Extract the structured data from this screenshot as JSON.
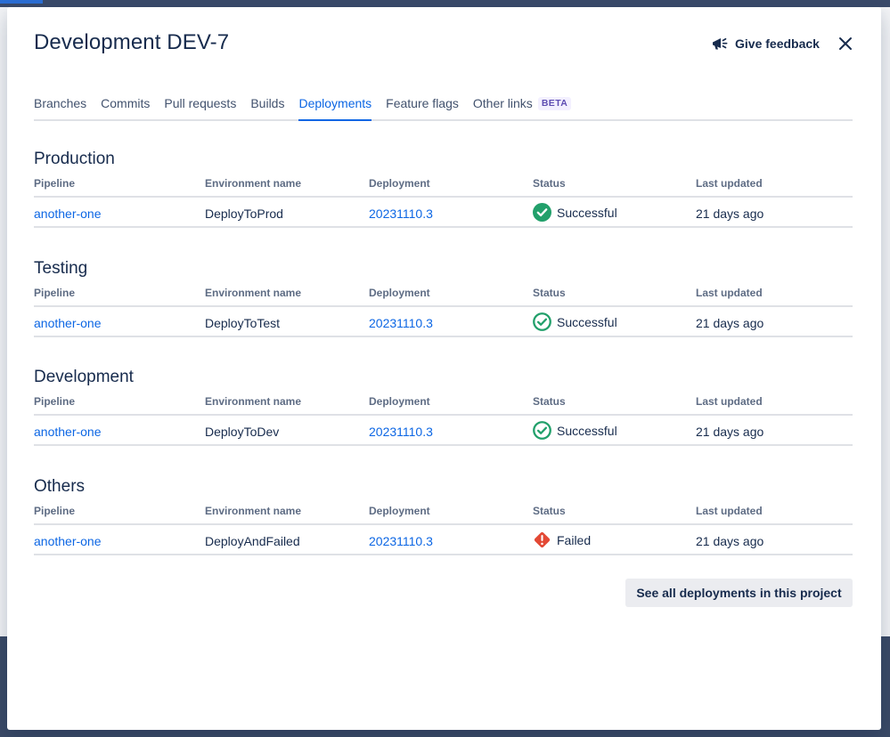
{
  "modal": {
    "title": "Development DEV-7",
    "feedback_label": "Give feedback"
  },
  "tabs": [
    {
      "label": "Branches"
    },
    {
      "label": "Commits"
    },
    {
      "label": "Pull requests"
    },
    {
      "label": "Builds"
    },
    {
      "label": "Deployments",
      "active": true
    },
    {
      "label": "Feature flags"
    },
    {
      "label": "Other links",
      "badge": "BETA"
    }
  ],
  "columns": [
    "Pipeline",
    "Environment name",
    "Deployment",
    "Status",
    "Last updated"
  ],
  "sections": [
    {
      "title": "Production",
      "row": {
        "pipeline": "another-one",
        "environment": "DeployToProd",
        "deployment": "20231110.3",
        "status": "Successful",
        "status_icon": "check-circle-filled-icon",
        "updated": "21 days ago"
      }
    },
    {
      "title": "Testing",
      "row": {
        "pipeline": "another-one",
        "environment": "DeployToTest",
        "deployment": "20231110.3",
        "status": "Successful",
        "status_icon": "check-circle-outline-icon",
        "updated": "21 days ago"
      }
    },
    {
      "title": "Development",
      "row": {
        "pipeline": "another-one",
        "environment": "DeployToDev",
        "deployment": "20231110.3",
        "status": "Successful",
        "status_icon": "check-circle-outline-icon",
        "updated": "21 days ago"
      }
    },
    {
      "title": "Others",
      "row": {
        "pipeline": "another-one",
        "environment": "DeployAndFailed",
        "deployment": "20231110.3",
        "status": "Failed",
        "status_icon": "error-diamond-icon",
        "updated": "21 days ago"
      }
    }
  ],
  "see_all_label": "See all deployments in this project",
  "colors": {
    "link": "#0c66e4",
    "success": "#22a06b",
    "error": "#e34935",
    "text": "#172b4d"
  }
}
